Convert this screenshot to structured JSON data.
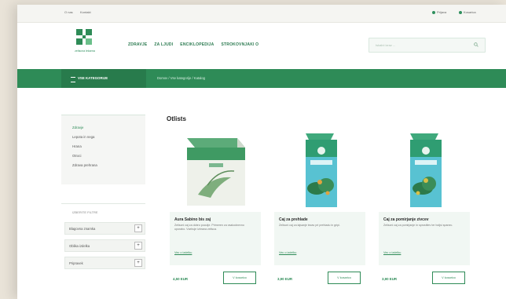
{
  "topbar": {
    "left_links": [
      "O nas",
      "Kontakt"
    ],
    "right_links": [
      "Prijava",
      "Kosarica"
    ]
  },
  "logo": {
    "text": "zeliscna lekarna",
    "brand_color": "#2e8b57"
  },
  "nav": {
    "items": [
      "ZDRAVJE",
      "ZA LJUDI",
      "ENCIKLOPEDIJA",
      "STROKOVNJAKI O"
    ]
  },
  "search": {
    "placeholder": "Iskalni izraz ...",
    "icon": "search-icon"
  },
  "category_button": {
    "label": "VSE KATEGORIJE",
    "icon": "menu-icon"
  },
  "breadcrumb": "Domov  /  Vse kategorije  /  Katalog",
  "sidebar": {
    "items": [
      "Zdravje",
      "Lepota in nega",
      "Hrana",
      "Otroci",
      "Zdrava prehrana"
    ],
    "filter_title": "IZBERITE FILTRE",
    "filters": [
      {
        "label": "Blagovna znamka",
        "icon": "plus-icon"
      },
      {
        "label": "Oblika izdelka",
        "icon": "plus-icon"
      },
      {
        "label": "Pripravek",
        "icon": "plus-icon"
      }
    ]
  },
  "main": {
    "title": "Otlists",
    "products": [
      {
        "name": "Aura Sabino bis zaj",
        "description": "Zeliscni caj za dobro pocutje. Primeren za vsakodnevno uporabo. Vsebuje izbrana zelisca.",
        "more": "Vec o izdelku",
        "price": "4,50 EUR",
        "button": "V kosarico"
      },
      {
        "name": "Caj za prehlade",
        "description": "Zeliscni caj za lajsanje tezav pri prehladu in gripi.",
        "more": "Vec o izdelku",
        "price": "3,90 EUR",
        "button": "V kosarico"
      },
      {
        "name": "Caj za pomirjanje zivcev",
        "description": "Zeliscni caj za pomirjanje in sprostitev ter boljsi spanec.",
        "more": "Vec o izdelku",
        "price": "3,90 EUR",
        "button": "V kosarico"
      }
    ]
  }
}
